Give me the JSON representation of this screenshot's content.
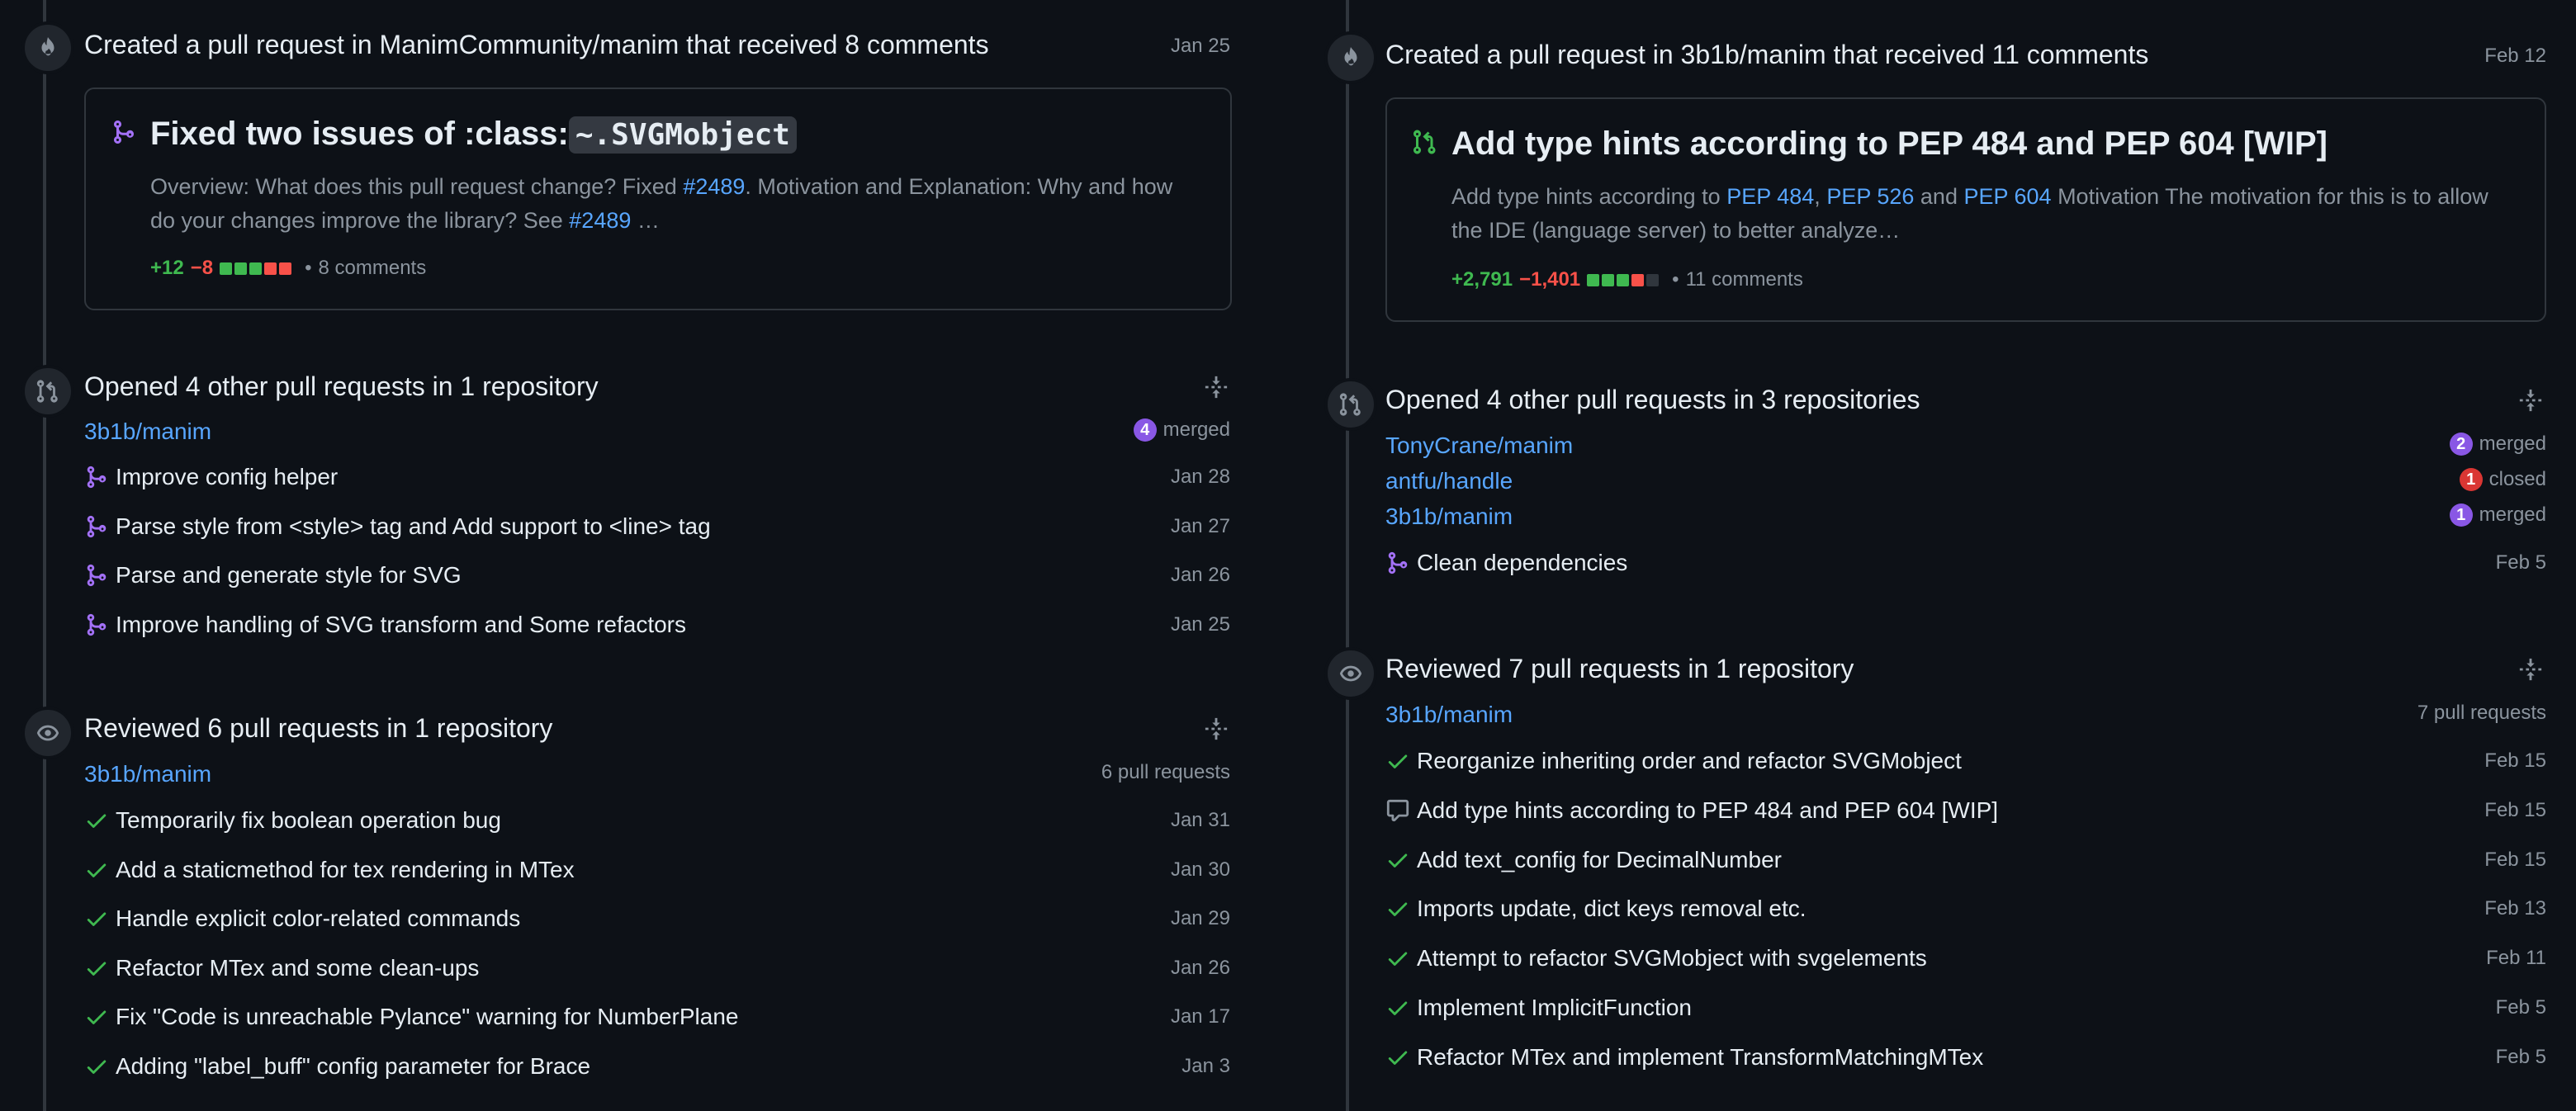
{
  "colors": {
    "background": "#0d1117",
    "text": "#e6edf3",
    "muted": "#8b949e",
    "link": "#58a6ff",
    "merged": "#8957e5",
    "closed": "#da3633",
    "additions": "#3fb950",
    "deletions": "#f85149"
  },
  "left": {
    "created": {
      "title": "Created a pull request in ManimCommunity/manim that received 8 comments",
      "date": "Jan 25",
      "card": {
        "title_prefix": "Fixed two issues of :class:",
        "title_code": "~.SVGMobject",
        "body_1": "Overview: What does this pull request change? Fixed ",
        "link_1": "#2489",
        "body_2": ". Motivation and Explanation: Why and how do your changes improve the library? See ",
        "link_2": "#2489",
        "body_3": " …",
        "additions": "+12",
        "deletions": "−8",
        "comments": "8 comments"
      }
    },
    "opened": {
      "title": "Opened 4 other pull requests in 1 repository",
      "repo": "3b1b/manim",
      "merged_count": "4",
      "merged_label": "merged",
      "items": [
        {
          "title": "Improve config helper",
          "date": "Jan 28"
        },
        {
          "title": "Parse style from <style> tag and Add support to <line> tag",
          "date": "Jan 27"
        },
        {
          "title": "Parse and generate style for SVG",
          "date": "Jan 26"
        },
        {
          "title": "Improve handling of SVG transform and Some refactors",
          "date": "Jan 25"
        }
      ]
    },
    "reviewed": {
      "title": "Reviewed 6 pull requests in 1 repository",
      "repo": "3b1b/manim",
      "count_label": "6 pull requests",
      "items": [
        {
          "title": "Temporarily fix boolean operation bug",
          "date": "Jan 31"
        },
        {
          "title": "Add a staticmethod for tex rendering in MTex",
          "date": "Jan 30"
        },
        {
          "title": "Handle explicit color-related commands",
          "date": "Jan 29"
        },
        {
          "title": "Refactor MTex and some clean-ups",
          "date": "Jan 26"
        },
        {
          "title": "Fix \"Code is unreachable Pylance\" warning for NumberPlane",
          "date": "Jan 17"
        },
        {
          "title": "Adding \"label_buff\" config parameter for Brace",
          "date": "Jan 3"
        }
      ]
    }
  },
  "right": {
    "created": {
      "title": "Created a pull request in 3b1b/manim that received 11 comments",
      "date": "Feb 12",
      "card": {
        "title": "Add type hints according to PEP 484 and PEP 604 [WIP]",
        "body_1": "Add type hints according to ",
        "link_1": "PEP 484",
        "sep_1": ", ",
        "link_2": "PEP 526",
        "sep_2": " and ",
        "link_3": "PEP 604",
        "body_2": " Motivation The motivation for this is to allow the IDE (language server) to better analyze…",
        "additions": "+2,791",
        "deletions": "−1,401",
        "comments": "11 comments"
      }
    },
    "opened": {
      "title": "Opened 4 other pull requests in 3 repositories",
      "repos": [
        {
          "name": "TonyCrane/manim",
          "count": "2",
          "status": "merged"
        },
        {
          "name": "antfu/handle",
          "count": "1",
          "status": "closed"
        },
        {
          "name": "3b1b/manim",
          "count": "1",
          "status": "merged"
        }
      ],
      "items": [
        {
          "title": "Clean dependencies",
          "date": "Feb 5"
        }
      ]
    },
    "reviewed": {
      "title": "Reviewed 7 pull requests in 1 repository",
      "repo": "3b1b/manim",
      "count_label": "7 pull requests",
      "items": [
        {
          "title": "Reorganize inheriting order and refactor SVGMobject",
          "date": "Feb 15",
          "icon": "check-icon"
        },
        {
          "title": "Add type hints according to PEP 484 and PEP 604 [WIP]",
          "date": "Feb 15",
          "icon": "comment-icon"
        },
        {
          "title": "Add text_config for DecimalNumber",
          "date": "Feb 15",
          "icon": "check-icon"
        },
        {
          "title": "Imports update, dict keys removal etc.",
          "date": "Feb 13",
          "icon": "check-icon"
        },
        {
          "title": "Attempt to refactor SVGMobject with svgelements",
          "date": "Feb 11",
          "icon": "check-icon"
        },
        {
          "title": "Implement ImplicitFunction",
          "date": "Feb 5",
          "icon": "check-icon"
        },
        {
          "title": "Refactor MTex and implement TransformMatchingMTex",
          "date": "Feb 5",
          "icon": "check-icon"
        }
      ]
    }
  }
}
